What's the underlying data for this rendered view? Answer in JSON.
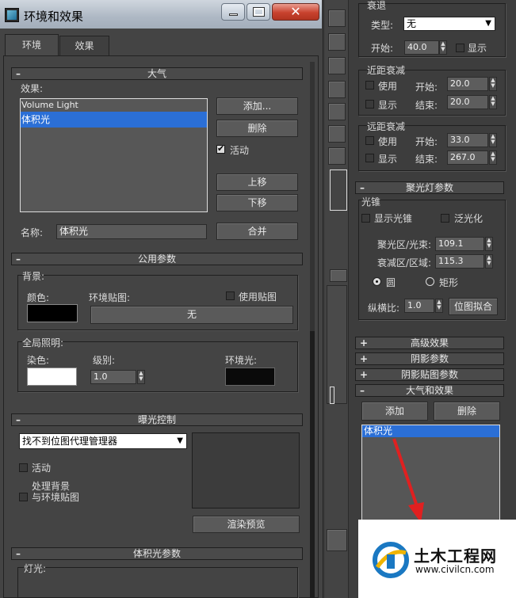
{
  "window": {
    "title": "环境和效果"
  },
  "tabs": [
    {
      "label": "环境"
    },
    {
      "label": "效果"
    }
  ],
  "atmosphere": {
    "title": "大气",
    "effects_label": "效果:",
    "effects": [
      "Volume Light",
      "体积光"
    ],
    "buttons": {
      "add": "添加...",
      "delete": "删除",
      "move_up": "上移",
      "move_down": "下移",
      "merge": "合并"
    },
    "active_label": "活动",
    "name_label": "名称:",
    "name_value": "体积光"
  },
  "common": {
    "title": "公用参数",
    "background": "背景:",
    "color": "颜色:",
    "env_map": "环境贴图:",
    "use_map": "使用贴图",
    "env_map_button": "无",
    "global_lighting": "全局照明:",
    "tint": "染色:",
    "level": "级别:",
    "level_value": "1.0",
    "ambient": "环境光:",
    "colors": {
      "bg": "#000000",
      "tint": "#ffffff",
      "ambient": "#0a0a0a"
    }
  },
  "exposure": {
    "title": "曝光控制",
    "dropdown": "找不到位图代理管理器",
    "active": "活动",
    "process_bg_line1": "处理背景",
    "process_bg_line2": "与环境贴图",
    "render_preview": "渲染预览"
  },
  "volume_light": {
    "title": "体积光参数",
    "lights": "灯光:"
  },
  "right": {
    "decay": {
      "title": "衰退",
      "type_label": "类型:",
      "type_value": "无",
      "start_label": "开始:",
      "start_value": "40.0",
      "show_label": "显示"
    },
    "near_atten": {
      "title": "近距衰减",
      "use": "使用",
      "show": "显示",
      "start": "开始:",
      "end": "结束:",
      "start_value": "20.0",
      "end_value": "20.0"
    },
    "far_atten": {
      "title": "远距衰减",
      "use": "使用",
      "show": "显示",
      "start": "开始:",
      "end": "结束:",
      "start_value": "33.0",
      "end_value": "267.0"
    },
    "spot": {
      "title": "聚光灯参数",
      "cone": "光锥",
      "show_cone": "显示光锥",
      "overshoot": "泛光化",
      "hotspot_label": "聚光区/光束:",
      "hotspot_value": "109.1",
      "falloff_label": "衰减区/区域:",
      "falloff_value": "115.3",
      "circle": "圆",
      "rectangle": "矩形",
      "aspect_label": "纵横比:",
      "aspect_value": "1.0",
      "bitmap_fit": "位图拟合"
    },
    "rollouts": [
      "高级效果",
      "阴影参数",
      "阴影贴图参数"
    ],
    "atm_effects": {
      "title": "大气和效果",
      "add": "添加",
      "delete": "删除",
      "items": [
        "体积光"
      ]
    },
    "watermark": {
      "name": "土木工程网",
      "url": "www.civilcn.com"
    }
  }
}
